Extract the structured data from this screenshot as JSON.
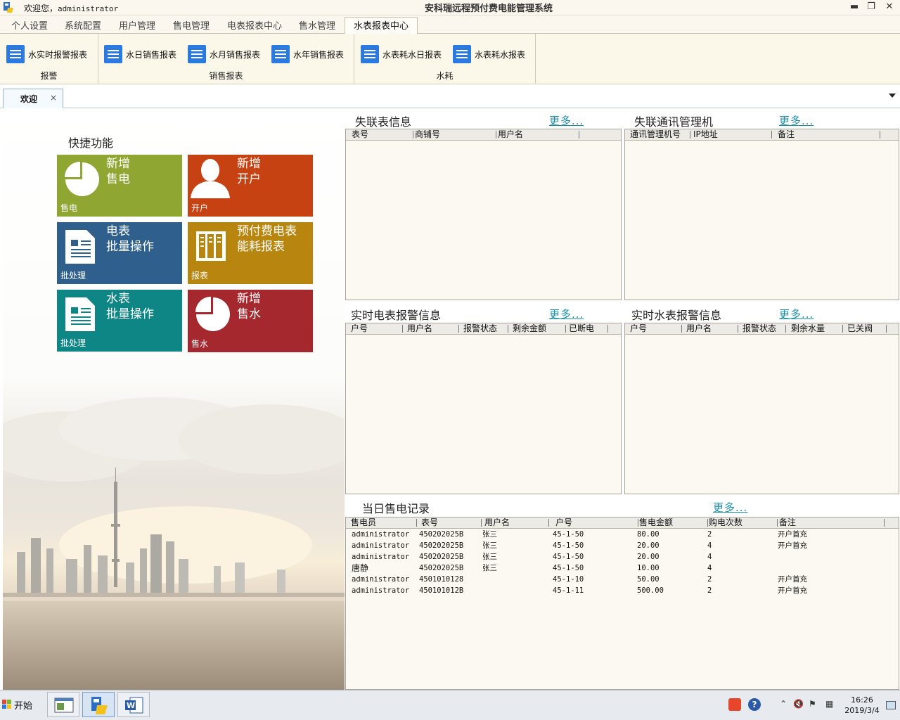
{
  "titlebar": {
    "welcome_prefix": "欢迎您，",
    "user": "administrator",
    "app_title": "安科瑞远程预付费电能管理系统",
    "minimize": "▬",
    "restore": "❐",
    "close": "✕"
  },
  "menu": {
    "tabs": [
      {
        "label": "个人设置"
      },
      {
        "label": "系统配置"
      },
      {
        "label": "用户管理"
      },
      {
        "label": "售电管理"
      },
      {
        "label": "电表报表中心"
      },
      {
        "label": "售水管理"
      },
      {
        "label": "水表报表中心"
      }
    ],
    "active_tab": "水表报表中心"
  },
  "ribbon": {
    "groups": [
      {
        "label": "报警",
        "buttons": [
          {
            "label": "水实时报警报表"
          }
        ]
      },
      {
        "label": "销售报表",
        "buttons": [
          {
            "label": "水日销售报表"
          },
          {
            "label": "水月销售报表"
          },
          {
            "label": "水年销售报表"
          }
        ]
      },
      {
        "label": "水耗",
        "buttons": [
          {
            "label": "水表耗水日报表"
          },
          {
            "label": "水表耗水报表"
          }
        ]
      }
    ]
  },
  "doc_tab": {
    "label": "欢迎",
    "close": "×"
  },
  "quick": {
    "title": "快捷功能",
    "tiles": [
      {
        "title": "新增\n售电",
        "badge": "售电",
        "color": "#8fa632",
        "icon": "pie-chart-icon"
      },
      {
        "title": "新增\n开户",
        "badge": "开户",
        "color": "#c74212",
        "icon": "user-icon"
      },
      {
        "title": "电表\n批量操作",
        "badge": "批处理",
        "color": "#2e5f8d",
        "icon": "document-icon"
      },
      {
        "title": "预付费电表\n能耗报表",
        "badge": "报表",
        "color": "#b8860f",
        "icon": "report-icon"
      },
      {
        "title": "水表\n批量操作",
        "badge": "批处理",
        "color": "#0f8686",
        "icon": "document-icon"
      },
      {
        "title": "新增\n售水",
        "badge": "售水",
        "color": "#a4282e",
        "icon": "pie-chart-icon"
      }
    ]
  },
  "panels": {
    "offline_meters": {
      "title": "失联表信息",
      "more": "更多...",
      "columns": [
        "表号",
        "商铺号",
        "用户名"
      ]
    },
    "offline_concentrators": {
      "title": "失联通讯管理机",
      "more": "更多...",
      "columns": [
        "通讯管理机号",
        "IP地址",
        "备注"
      ]
    },
    "power_alarms": {
      "title": "实时电表报警信息",
      "more": "更多...",
      "columns": [
        "户号",
        "用户名",
        "报警状态",
        "剩余金额",
        "已断电"
      ]
    },
    "water_alarms": {
      "title": "实时水表报警信息",
      "more": "更多...",
      "columns": [
        "户号",
        "用户名",
        "报警状态",
        "剩余水量",
        "已关阀"
      ]
    },
    "sales": {
      "title": "当日售电记录",
      "more": "更多...",
      "columns": [
        "售电员",
        "表号",
        "用户名",
        "户号",
        "售电金额",
        "购电次数",
        "备注"
      ],
      "rows": [
        [
          "administrator",
          "450202025B",
          "张三",
          "45-1-50",
          "80.00",
          "2",
          "开户首充"
        ],
        [
          "administrator",
          "450202025B",
          "张三",
          "45-1-50",
          "20.00",
          "4",
          "开户首充"
        ],
        [
          "administrator",
          "450202025B",
          "张三",
          "45-1-50",
          "20.00",
          "4",
          ""
        ],
        [
          "唐静",
          "450202025B",
          "张三",
          "45-1-50",
          "10.00",
          "4",
          ""
        ],
        [
          "administrator",
          "4501010128",
          "",
          "45-1-10",
          "50.00",
          "2",
          "开户首充"
        ],
        [
          "administrator",
          "450101012B",
          "",
          "45-1-11",
          "500.00",
          "2",
          "开户首充"
        ]
      ]
    }
  },
  "taskbar": {
    "start": "开始",
    "time": "16:26",
    "date": "2019/3/4"
  }
}
